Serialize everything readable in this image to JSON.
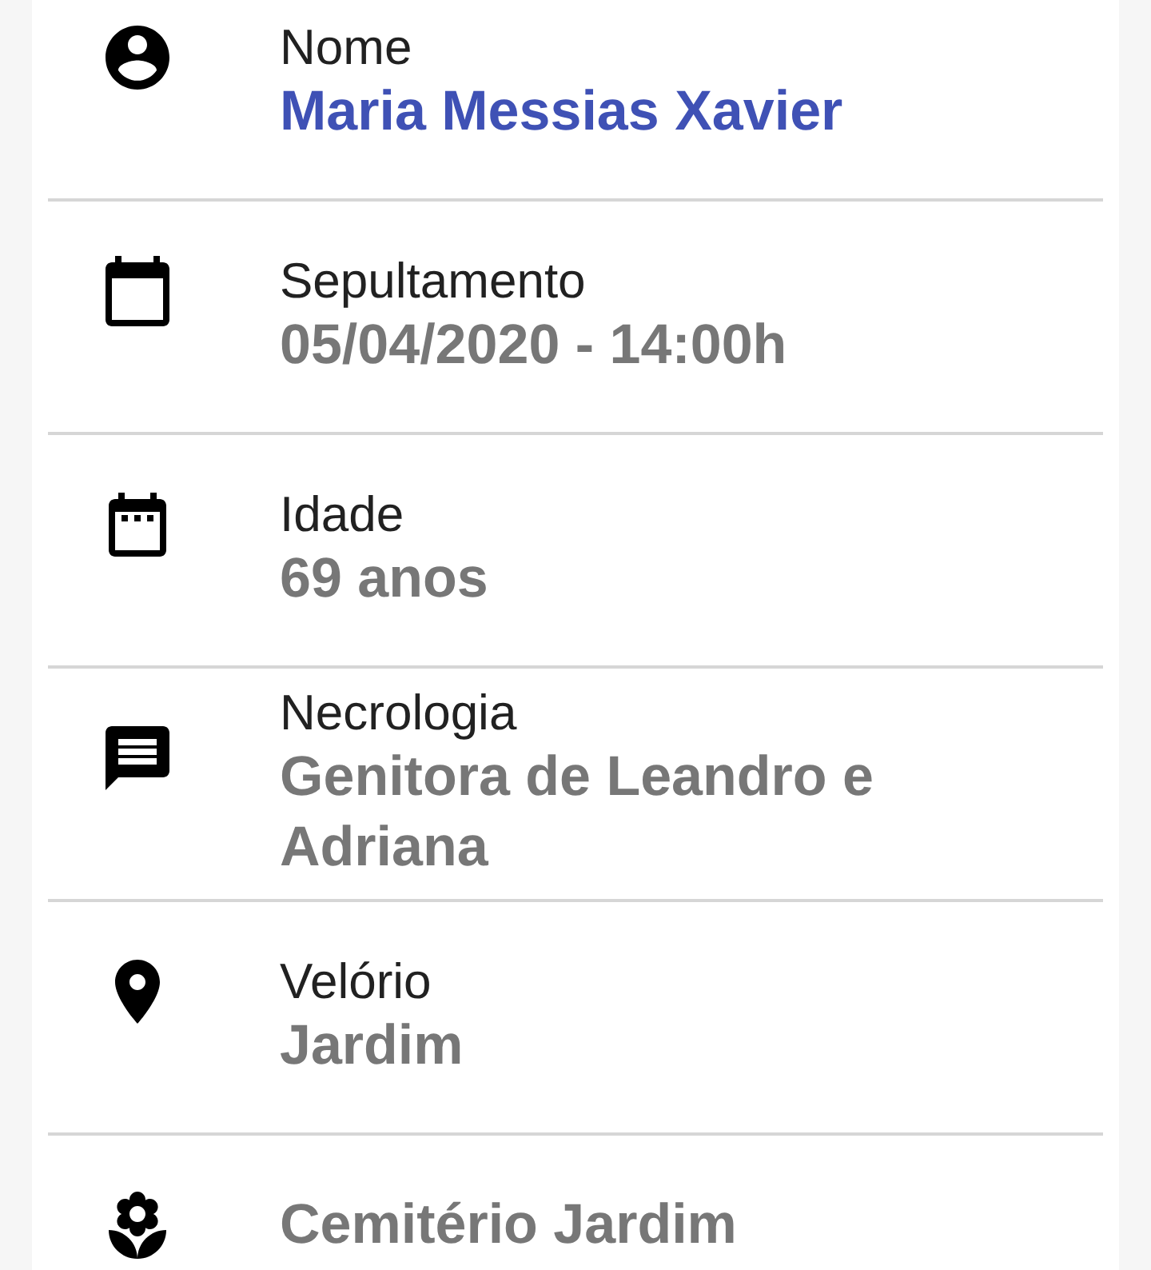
{
  "details": [
    {
      "kind": "person",
      "label": "Nome",
      "value": "Maria Messias Xavier",
      "primary": true
    },
    {
      "kind": "calendar",
      "label": "Sepultamento",
      "value": "05/04/2020 - 14:00h",
      "primary": false
    },
    {
      "kind": "calendar-dots",
      "label": "Idade",
      "value": "69 anos",
      "primary": false
    },
    {
      "kind": "message",
      "label": "Necrologia",
      "value": "Genitora de Leandro e Adriana",
      "primary": false
    },
    {
      "kind": "place",
      "label": "Velório",
      "value": "Jardim",
      "primary": false
    },
    {
      "kind": "flower",
      "value": "Cemitério Jardim",
      "primary": false
    }
  ]
}
